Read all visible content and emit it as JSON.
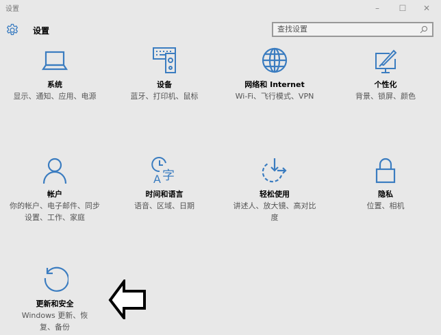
{
  "window": {
    "title": "设置",
    "minimize": "–",
    "maximize": "☐",
    "close": "✕"
  },
  "header": {
    "title": "设置",
    "search_placeholder": "查找设置"
  },
  "tiles": [
    {
      "title": "系统",
      "desc": "显示、通知、应用、电源",
      "icon": "laptop-icon"
    },
    {
      "title": "设备",
      "desc": "蓝牙、打印机、鼠标",
      "icon": "devices-icon"
    },
    {
      "title": "网络和 Internet",
      "desc": "Wi-Fi、飞行模式、VPN",
      "icon": "globe-icon"
    },
    {
      "title": "个性化",
      "desc": "背景、锁屏、颜色",
      "icon": "personalization-icon"
    },
    {
      "title": "帐户",
      "desc": "你的帐户、电子邮件、同步设置、工作、家庭",
      "icon": "person-icon"
    },
    {
      "title": "时间和语言",
      "desc": "语音、区域、日期",
      "icon": "time-language-icon"
    },
    {
      "title": "轻松使用",
      "desc": "讲述人、放大镜、高对比度",
      "icon": "ease-of-access-icon"
    },
    {
      "title": "隐私",
      "desc": "位置、相机",
      "icon": "lock-icon"
    },
    {
      "title": "更新和安全",
      "desc": "Windows 更新、恢复、备份",
      "icon": "update-icon"
    }
  ],
  "colors": {
    "accent": "#3a7cc0",
    "background": "#e8e8e8"
  }
}
